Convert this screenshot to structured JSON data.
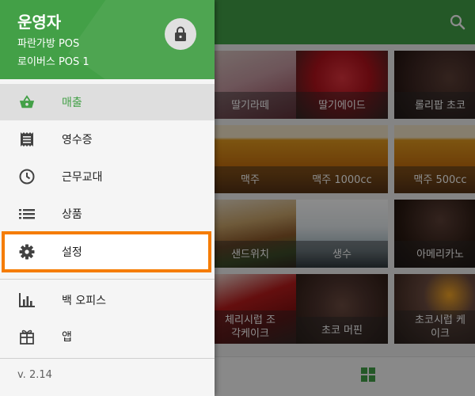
{
  "drawer": {
    "user_name": "운영자",
    "store_name": "파란가방 POS",
    "pos_name": "로이버스 POS 1",
    "lock_icon": "lock-icon",
    "items": [
      {
        "label": "매출",
        "icon": "basket-icon",
        "active": true
      },
      {
        "label": "영수증",
        "icon": "receipt-icon"
      },
      {
        "label": "근무교대",
        "icon": "clock-icon"
      },
      {
        "label": "상품",
        "icon": "list-icon"
      },
      {
        "label": "설정",
        "icon": "gear-icon",
        "highlighted": true
      },
      {
        "label": "백 오피스",
        "icon": "bar-chart-icon"
      },
      {
        "label": "앱",
        "icon": "puzzle-icon"
      }
    ],
    "version": "v. 2.14"
  },
  "products": [
    {
      "name": "딸기라떼"
    },
    {
      "name": "딸기에이드"
    },
    {
      "name": "롤리팝 초코"
    },
    {
      "name": "맥주"
    },
    {
      "name": "맥주 1000cc"
    },
    {
      "name": "맥주 500cc"
    },
    {
      "name": "샌드위치"
    },
    {
      "name": "생수"
    },
    {
      "name": "아메리카노"
    },
    {
      "name": "체리시럽 조\n각케이크"
    },
    {
      "name": "초코 머핀"
    },
    {
      "name": "초코시럽 케\n이크"
    }
  ],
  "colors": {
    "primary": "#43a047",
    "highlight": "#f57c00"
  }
}
